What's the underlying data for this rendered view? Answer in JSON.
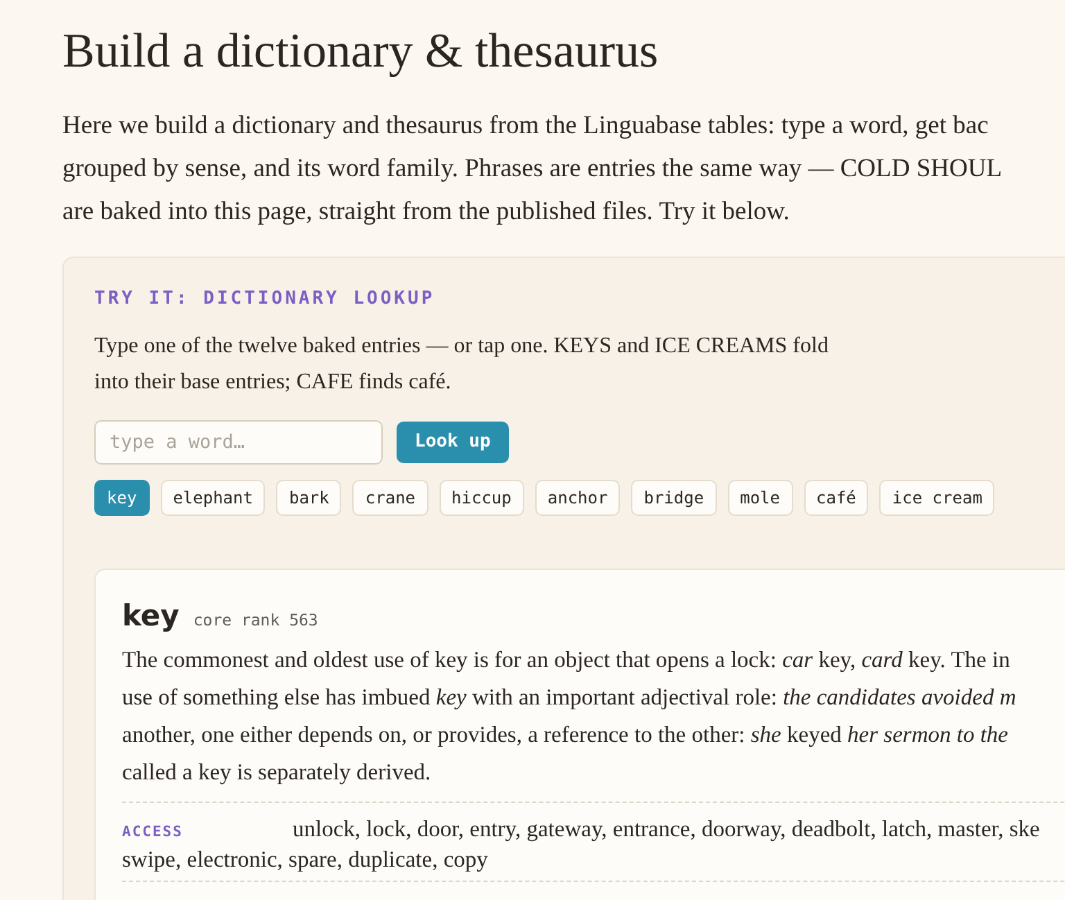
{
  "title": "Build a dictionary & thesaurus",
  "intro_lines": [
    "Here we build a dictionary and thesaurus from the Linguabase tables: type a word, get bac",
    "grouped by sense, and its word family. Phrases are entries the same way — COLD SHOUL",
    "are baked into this page, straight from the published files. Try it below."
  ],
  "demo": {
    "heading": "TRY IT: DICTIONARY LOOKUP",
    "instructions": [
      "Type one of the twelve baked entries — or tap one. KEYS and ICE CREAMS fold",
      "into their base entries; CAFE finds café."
    ],
    "search": {
      "placeholder": "type a word…"
    },
    "button": "Look up",
    "chips": [
      {
        "label": "key",
        "selected": true
      },
      {
        "label": "elephant",
        "selected": false
      },
      {
        "label": "bark",
        "selected": false
      },
      {
        "label": "crane",
        "selected": false
      },
      {
        "label": "hiccup",
        "selected": false
      },
      {
        "label": "anchor",
        "selected": false
      },
      {
        "label": "bridge",
        "selected": false
      },
      {
        "label": "mole",
        "selected": false
      },
      {
        "label": "café",
        "selected": false
      },
      {
        "label": "ice cream",
        "selected": false
      }
    ],
    "entry": {
      "word": "key",
      "rank": "core rank 563",
      "definition_lines": [
        "The commonest and oldest use of key is for an object that opens a lock: *car* key, *card* key. The in",
        "use of something else has imbued *key* with an important adjectival role: *the candidates avoided m*",
        "another, one either depends on, or provides, a reference to the other: *she* keyed *her sermon to the*",
        "called a key is separately derived."
      ],
      "senses": [
        {
          "label": "ACCESS",
          "lines": [
            "unlock, lock, door, entry, gateway, entrance, doorway, deadbolt, latch, master, ske",
            "swipe, electronic, spare, duplicate, copy"
          ]
        }
      ]
    }
  }
}
